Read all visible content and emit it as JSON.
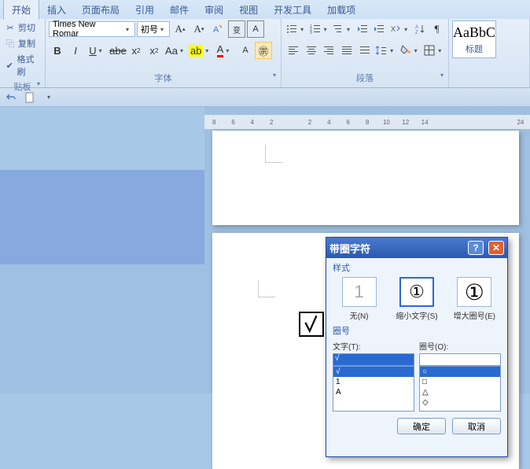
{
  "tabs": [
    "开始",
    "插入",
    "页面布局",
    "引用",
    "邮件",
    "审阅",
    "视图",
    "开发工具",
    "加载项"
  ],
  "active_tab": 0,
  "clipboard": {
    "cut": "剪切",
    "copy": "复制",
    "paint": "格式刷",
    "label": "贴板"
  },
  "font": {
    "name": "Times New Romar",
    "size": "初号",
    "label": "字体"
  },
  "para": {
    "label": "段落"
  },
  "style": {
    "sample": "AaBbC",
    "name": "标题"
  },
  "ruler_marks": [
    "8",
    "6",
    "4",
    "2",
    "",
    "2",
    "4",
    "6",
    "8",
    "10",
    "12",
    "14",
    "",
    "",
    "",
    "",
    "24"
  ],
  "dialog": {
    "title": "带圈字符",
    "section_style": "样式",
    "opts": [
      {
        "glyph": "1",
        "label": "无(N)"
      },
      {
        "glyph": "①",
        "label": "缩小文字(S)"
      },
      {
        "glyph": "①",
        "label": "增大圈号(E)"
      }
    ],
    "selected_opt": 1,
    "section_enclose": "圈号",
    "text_label": "文字(T):",
    "enclose_label": "圈号(O):",
    "text_value": "√",
    "text_items": [
      "√",
      "1",
      "A"
    ],
    "enclose_items": [
      "○",
      "□",
      "△",
      "◇"
    ],
    "ok": "确定",
    "cancel": "取消"
  }
}
